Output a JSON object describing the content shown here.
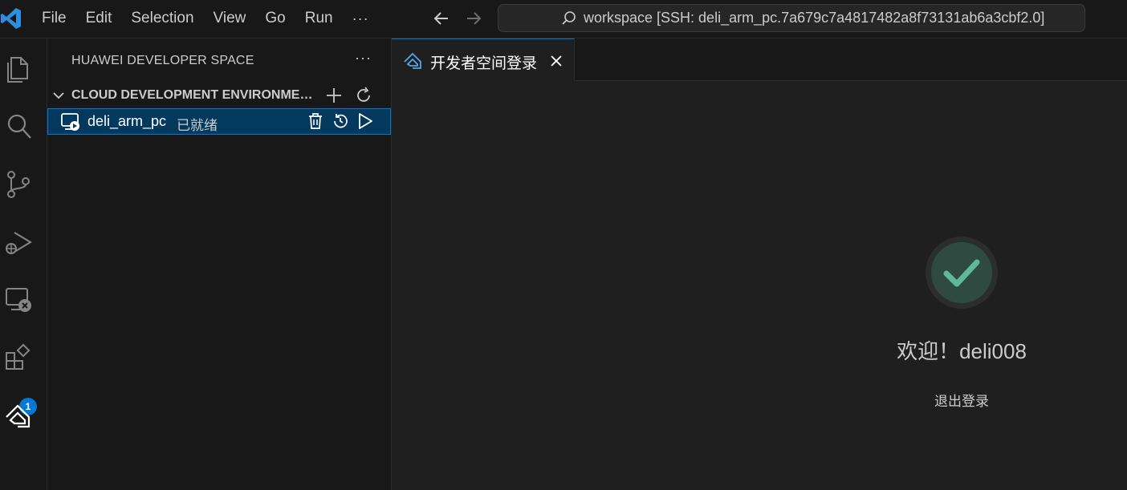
{
  "menu": {
    "items": [
      "File",
      "Edit",
      "Selection",
      "View",
      "Go",
      "Run"
    ],
    "more": "···"
  },
  "command_center": {
    "text": "workspace [SSH: deli_arm_pc.7a679c7a4817482a8f73131ab6a3cbf2.0]"
  },
  "activity_bar": {
    "icons": [
      "explorer-icon",
      "search-icon",
      "source-control-icon",
      "run-debug-icon",
      "remote-explorer-icon",
      "extensions-icon",
      "huawei-developer-space-icon"
    ],
    "extensions_badge": "1"
  },
  "sidebar": {
    "title": "HUAWEI DEVELOPER SPACE",
    "more": "···",
    "section_title": "CLOUD DEVELOPMENT ENVIRONMENTS",
    "environment": {
      "name": "deli_arm_pc",
      "status": "已就绪"
    }
  },
  "editor": {
    "tab_label": "开发者空间登录",
    "welcome": "欢迎！deli008",
    "logout": "退出登录"
  },
  "colors": {
    "accent": "#0078d4",
    "check": "#5fb89a",
    "check_bg": "#2f4a41"
  }
}
